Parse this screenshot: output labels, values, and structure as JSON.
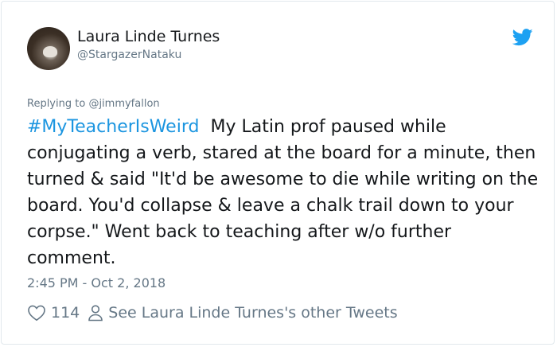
{
  "author": {
    "display_name": "Laura Linde Turnes",
    "handle": "@StargazerNataku"
  },
  "reply": {
    "prefix": "Replying to ",
    "mention": "@jimmyfallon"
  },
  "tweet": {
    "hashtag": "#MyTeacherIsWeird",
    "body": "My Latin prof paused while conjugating a verb, stared at the board for a minute, then turned & said \"It'd be awesome to die while writing on the board. You'd collapse & leave a chalk trail down to your corpse.\" Went back to teaching after w/o further comment.",
    "timestamp": "2:45 PM - Oct 2, 2018"
  },
  "actions": {
    "like_count": "114",
    "profile_link": "See Laura Linde Turnes's other Tweets"
  },
  "colors": {
    "accent": "#1b95e0",
    "secondary_text": "#657786",
    "primary_text": "#14171a",
    "twitter_blue": "#1da1f2"
  },
  "icons": {
    "brand": "twitter-bird-icon",
    "like": "heart-outline-icon",
    "profile": "person-outline-icon"
  }
}
